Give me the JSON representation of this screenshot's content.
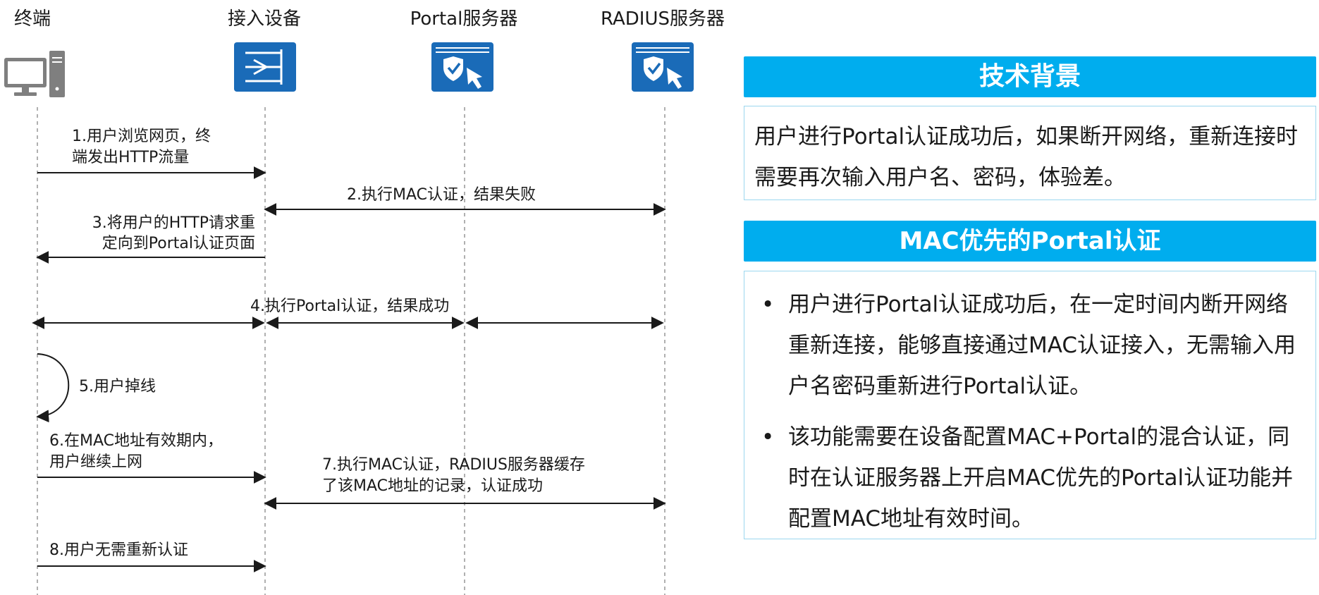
{
  "diagram": {
    "actors": [
      {
        "id": "terminal",
        "label": "终端",
        "icon": "computer-icon"
      },
      {
        "id": "access-device",
        "label": "接入设备",
        "icon": "switch-icon"
      },
      {
        "id": "portal-server",
        "label": "Portal服务器",
        "icon": "shield-cursor-icon"
      },
      {
        "id": "radius-server",
        "label": "RADIUS服务器",
        "icon": "shield-cursor-icon"
      }
    ],
    "messages": [
      {
        "step": 1,
        "lines": [
          "1.用户浏览网页，终",
          "端发出HTTP流量"
        ],
        "from": "terminal",
        "to": "access-device"
      },
      {
        "step": 2,
        "lines": [
          "2.执行MAC认证，结果失败"
        ],
        "from": "access-device",
        "to": "radius-server",
        "bidirectional": true
      },
      {
        "step": 3,
        "lines": [
          "3.将用户的HTTP请求重",
          "定向到Portal认证页面"
        ],
        "from": "access-device",
        "to": "terminal"
      },
      {
        "step": 4,
        "lines": [
          "4.执行Portal认证，结果成功"
        ],
        "segments": [
          [
            "terminal",
            "access-device"
          ],
          [
            "access-device",
            "portal-server"
          ],
          [
            "portal-server",
            "radius-server"
          ]
        ],
        "bidirectional": true
      },
      {
        "step": 5,
        "lines": [
          "5.用户掉线"
        ],
        "self": "terminal"
      },
      {
        "step": 6,
        "lines": [
          "6.在MAC地址有效期内，",
          "用户继续上网"
        ],
        "from": "terminal",
        "to": "access-device"
      },
      {
        "step": 7,
        "lines": [
          "7.执行MAC认证，RADIUS服务器缓存",
          "了该MAC地址的记录，认证成功"
        ],
        "from": "access-device",
        "to": "radius-server",
        "bidirectional": true
      },
      {
        "step": 8,
        "lines": [
          "8.用户无需重新认证"
        ],
        "from": "terminal",
        "to": "access-device"
      }
    ]
  },
  "background_panel": {
    "title": "技术背景",
    "body": "用户进行Portal认证成功后，如果断开网络，重新连接时需要再次输入用户名、密码，体验差。"
  },
  "mac_panel": {
    "title": "MAC优先的Portal认证",
    "bullet_symbol": "•",
    "items": [
      "用户进行Portal认证成功后，在一定时间内断开网络重新连接，能够直接通过MAC认证接入，无需输入用户名密码重新进行Portal认证。",
      "该功能需要在设备配置MAC+Portal的混合认证，同时在认证服务器上开启MAC优先的Portal认证功能并配置MAC地址有效时间。"
    ]
  },
  "colors": {
    "accent": "#00adee",
    "icon_blue": "#1a6bb8",
    "panel_border": "#9bd7ef",
    "lifeline": "#b0b0b0",
    "arrow": "#1a1a1a"
  }
}
